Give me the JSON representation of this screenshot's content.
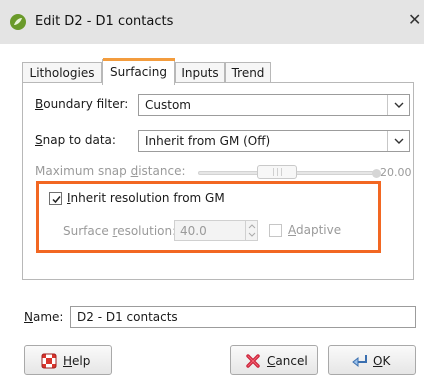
{
  "window": {
    "title": "Edit D2 - D1 contacts",
    "close_glyph": "✕"
  },
  "tabs": [
    {
      "label": "Lithologies",
      "active": false
    },
    {
      "label": "Surfacing",
      "active": true
    },
    {
      "label": "Inputs",
      "active": false
    },
    {
      "label": "Trend",
      "active": false
    }
  ],
  "surfacing": {
    "boundary_filter": {
      "label_mnemonic": "B",
      "label_rest": "oundary filter:",
      "value": "Custom"
    },
    "snap_to_data": {
      "label_mnemonic": "S",
      "label_rest": "nap to data:",
      "value": "Inherit from GM (Off)"
    },
    "max_snap": {
      "label_pre": "Maximum snap ",
      "label_mnemonic": "d",
      "label_post": "istance:",
      "value": "20.00",
      "enabled": false
    },
    "inherit_resolution": {
      "label_mnemonic": "I",
      "label_rest": "nherit resolution from GM",
      "checked": true
    },
    "surface_resolution": {
      "label_pre": "Surface ",
      "label_mnemonic": "r",
      "label_post": "esolution:",
      "value": "40.0",
      "enabled": false
    },
    "adaptive": {
      "label_mnemonic": "A",
      "label_rest": "daptive",
      "checked": false,
      "enabled": false
    }
  },
  "name": {
    "label_mnemonic": "N",
    "label_rest": "ame:",
    "value": "D2 - D1 contacts"
  },
  "buttons": {
    "help": {
      "mnemonic": "H",
      "rest": "elp",
      "icon": "lifebuoy-icon"
    },
    "cancel": {
      "mnemonic": "C",
      "rest": "ancel",
      "icon": "red-x-icon"
    },
    "ok": {
      "mnemonic": "O",
      "rest": "K",
      "icon": "enter-arrow-icon"
    }
  },
  "colors": {
    "highlight": "#f26722",
    "accent_tab": "#f39c3d"
  }
}
